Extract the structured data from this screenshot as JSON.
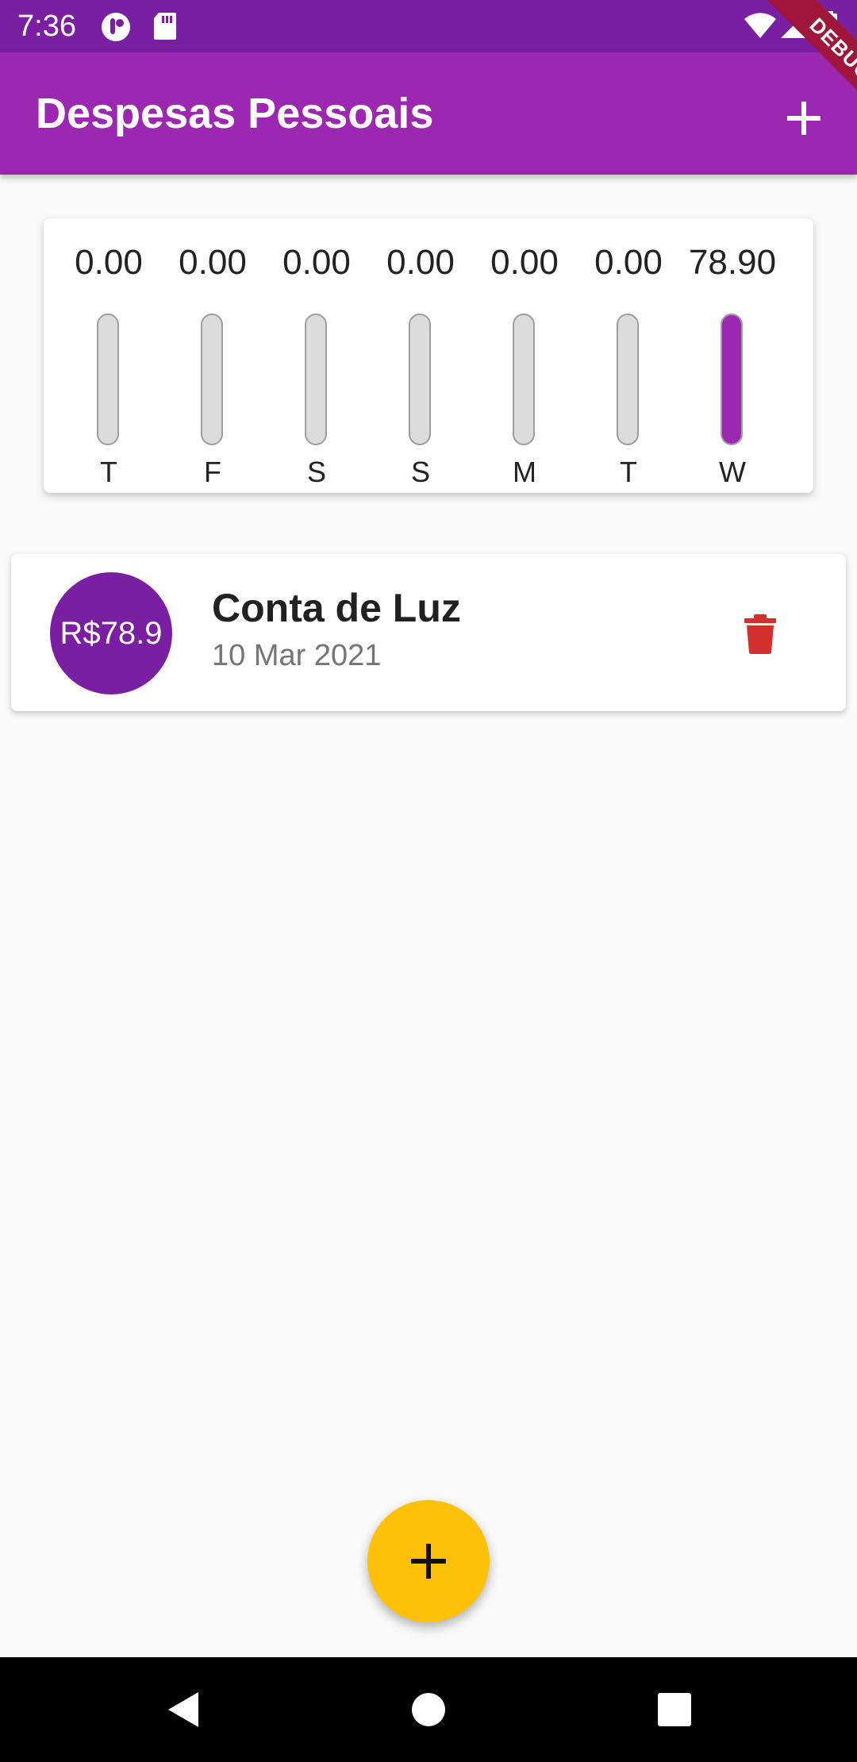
{
  "status_bar": {
    "time": "7:36"
  },
  "debug_banner": "DEBUG",
  "app_bar": {
    "title": "Despesas Pessoais"
  },
  "chart_data": {
    "type": "bar",
    "categories": [
      "T",
      "F",
      "S",
      "S",
      "M",
      "T",
      "W"
    ],
    "value_labels": [
      "0.00",
      "0.00",
      "0.00",
      "0.00",
      "0.00",
      "0.00",
      "78.90"
    ],
    "values": [
      0,
      0,
      0,
      0,
      0,
      0,
      78.9
    ],
    "fill_fraction": [
      0,
      0,
      0,
      0,
      0,
      0,
      1.0
    ],
    "bar_color": "#9c27b0",
    "track_color": "#dcdcdc"
  },
  "transactions": [
    {
      "amount": "R$78.9",
      "title": "Conta de Luz",
      "date": "10 Mar 2021"
    }
  ],
  "colors": {
    "primary": "#9c27b0",
    "primary_dark": "#7b1fa2",
    "accent": "#ffc107",
    "delete": "#d32f2f"
  }
}
